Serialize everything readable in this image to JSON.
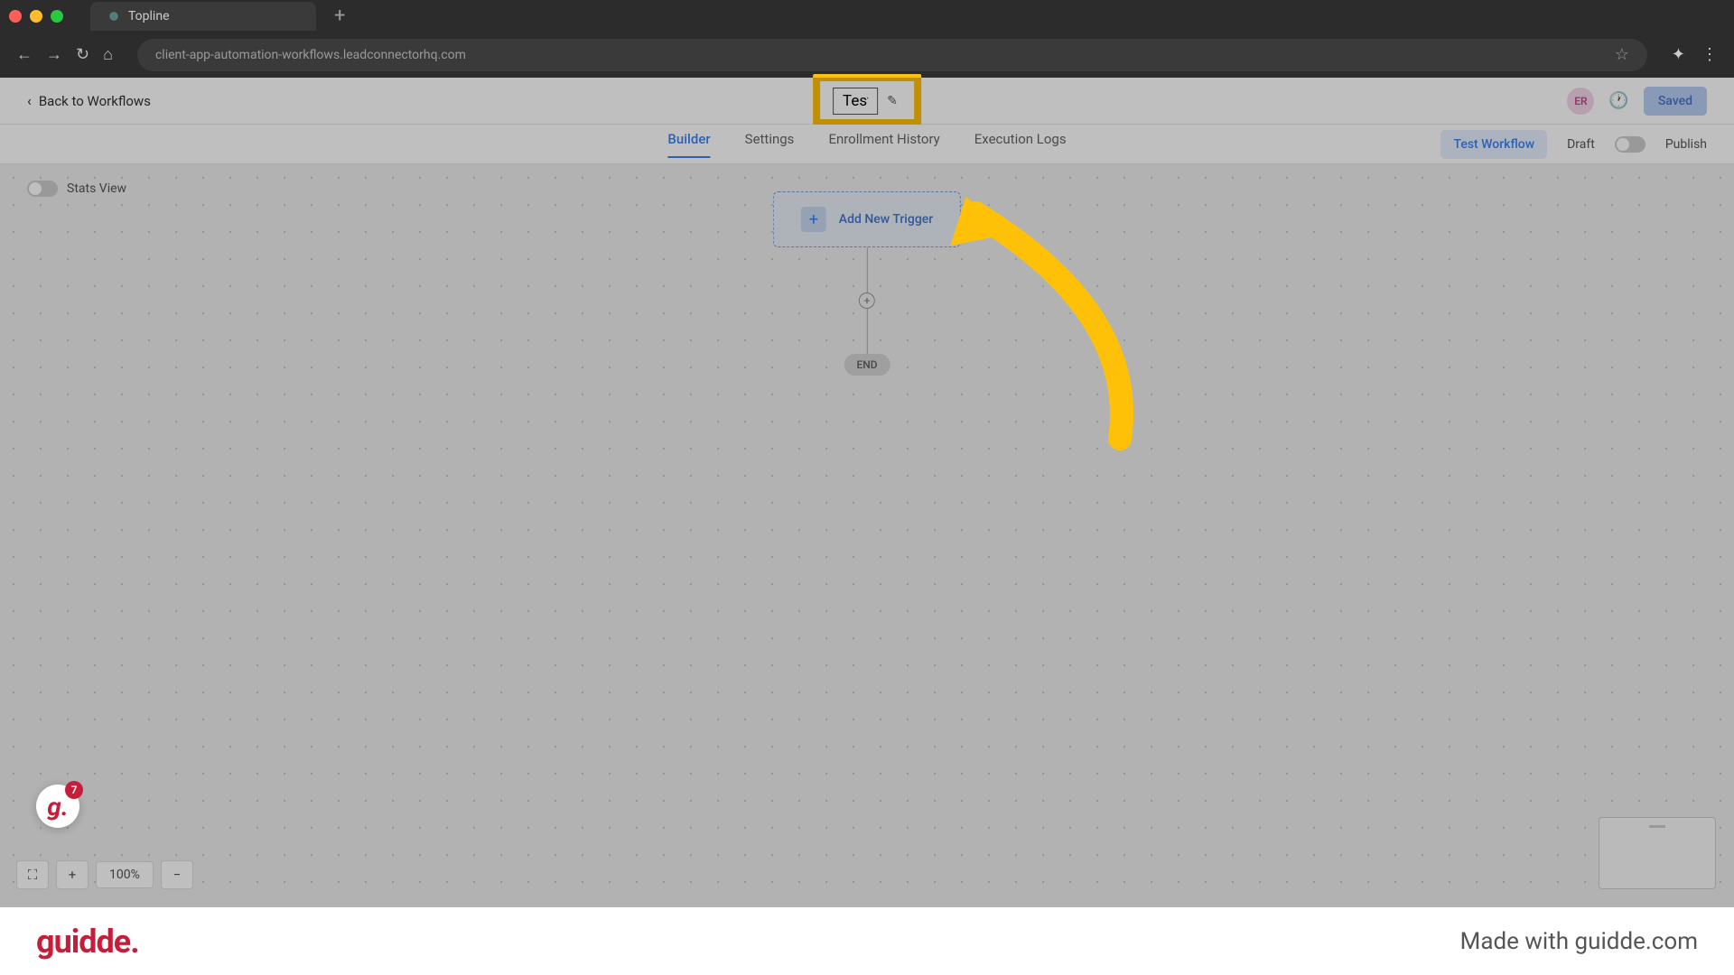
{
  "browser": {
    "tab_title": "Topline",
    "url": "client-app-automation-workflows.leadconnectorhq.com"
  },
  "header": {
    "back_label": "Back to Workflows",
    "title_value": "Test",
    "avatar_initials": "ER",
    "saved_label": "Saved"
  },
  "tabs": {
    "builder": "Builder",
    "settings": "Settings",
    "enrollment": "Enrollment History",
    "execution": "Execution Logs",
    "test_workflow": "Test Workflow",
    "draft": "Draft",
    "publish": "Publish"
  },
  "canvas": {
    "stats_view": "Stats View",
    "add_trigger": "Add New Trigger",
    "end": "END",
    "zoom_level": "100%"
  },
  "guidde": {
    "badge_count": "7",
    "logo_text": "guidde.",
    "footer_text": "Made with guidde.com"
  }
}
